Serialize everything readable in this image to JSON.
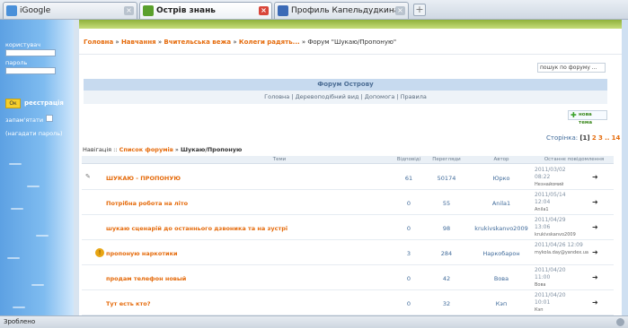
{
  "tabs": [
    {
      "label": "iGoogle",
      "active": false
    },
    {
      "label": "Острів знань",
      "active": true
    },
    {
      "label": "Профиль Капельдудкина - Пер…",
      "active": false
    }
  ],
  "sidebar": {
    "user_label": "користувач",
    "password_label": "пароль",
    "login_button": "Ок",
    "register_link": "реєстрація",
    "remember_label": "запам'ятати",
    "forgot_link": "(нагадати пароль)"
  },
  "breadcrumb": {
    "items": [
      "Головна",
      "Навчання",
      "Вчительська вежа",
      "Колеги радять..."
    ],
    "current": "Форум \"Шукаю/Пропоную\""
  },
  "search": {
    "placeholder": "пошук по форуму ..."
  },
  "island": {
    "title": "Форум Острову",
    "nav": "Головна | Деревоподібний вид | Допомога | Правила"
  },
  "new_topic": "нова тема",
  "pages": {
    "label": "Сторінка:",
    "current": "[1]",
    "links": [
      "2",
      "3",
      "..",
      "14"
    ]
  },
  "nav_line": {
    "prefix": "Навігація ::",
    "link": "Список форумів",
    "current": "Шукаю/Пропоную"
  },
  "table": {
    "headers": {
      "title": "Теми",
      "replies": "Відповіді",
      "views": "Перегляди",
      "author": "Автор",
      "last": "Останнє повідомлення"
    },
    "rows": [
      {
        "icon": "pin-icon",
        "title": "ШУКАЮ - ПРОПОНУЮ",
        "replies": "61",
        "views": "50174",
        "author": "Юрко",
        "last_date": "2011/03/02",
        "last_time": "08:22",
        "last_by": "Незнайомий"
      },
      {
        "icon": "",
        "title": "Потрібна робота на літо",
        "replies": "0",
        "views": "55",
        "author": "Anila1",
        "last_date": "2011/05/14",
        "last_time": "12:04",
        "last_by": "Anila1"
      },
      {
        "icon": "",
        "title": "шукаю сценарій до останнього дзвоника та на зустрі",
        "replies": "0",
        "views": "98",
        "author": "krukivskanvo2009",
        "last_date": "2011/04/29",
        "last_time": "13:06",
        "last_by": "krukivskanvo2009"
      },
      {
        "icon": "lock-icon",
        "title": "пропоную наркотики",
        "replies": "3",
        "views": "284",
        "author": "Наркобарон",
        "last_date": "2011/04/26 12:09",
        "last_time": "",
        "last_by": "mykola.day@yandex.ua"
      },
      {
        "icon": "",
        "title": "продам телефон новый",
        "replies": "0",
        "views": "42",
        "author": "Вова",
        "last_date": "2011/04/20",
        "last_time": "11:00",
        "last_by": "Вова"
      },
      {
        "icon": "",
        "title": "Тут есть кто?",
        "replies": "0",
        "views": "32",
        "author": "Кэп",
        "last_date": "2011/04/20",
        "last_time": "10:01",
        "last_by": "Кэп"
      }
    ]
  },
  "statusbar": {
    "text": "Зроблено"
  }
}
